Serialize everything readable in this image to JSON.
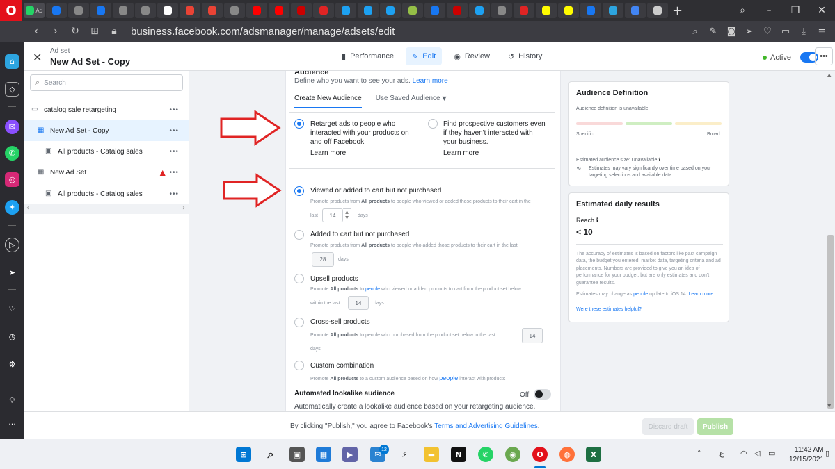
{
  "browser": {
    "url": "business.facebook.com/adsmanager/manage/adsets/edit",
    "logo": "O",
    "active_tab_label": "Ac",
    "tabs": [
      {
        "color": "#25d366",
        "icon": "whatsapp-icon"
      },
      {
        "color": "#1877f2",
        "icon": "meta-icon"
      },
      {
        "color": "#888888",
        "icon": "page-icon"
      },
      {
        "color": "#1877f2",
        "icon": "meta-icon"
      },
      {
        "color": "#888888",
        "icon": "circle-icon"
      },
      {
        "color": "#888888",
        "icon": "page-icon"
      },
      {
        "color": "#ffffff",
        "icon": "google-icon"
      },
      {
        "color": "#ea4335",
        "icon": "gmail-icon"
      },
      {
        "color": "#ea4335",
        "icon": "gmail-icon"
      },
      {
        "color": "#888888",
        "icon": "page-icon"
      },
      {
        "color": "#ff0000",
        "icon": "youtube-icon"
      },
      {
        "color": "#ff0000",
        "icon": "youtube-icon"
      },
      {
        "color": "#cc0000",
        "icon": "news-icon"
      },
      {
        "color": "#e02424",
        "icon": "chart-icon"
      },
      {
        "color": "#1da1f2",
        "icon": "twitter-icon"
      },
      {
        "color": "#1da1f2",
        "icon": "twitter-icon"
      },
      {
        "color": "#1da1f2",
        "icon": "twitter-icon"
      },
      {
        "color": "#95bf47",
        "icon": "shopify-icon"
      },
      {
        "color": "#1877f2",
        "icon": "facebook-icon"
      },
      {
        "color": "#cc0000",
        "icon": "news-icon"
      },
      {
        "color": "#1da1f2",
        "icon": "twitter-icon"
      },
      {
        "color": "#888888",
        "icon": "circle-icon"
      },
      {
        "color": "#e02424",
        "icon": "pin-icon"
      },
      {
        "color": "#fffc00",
        "icon": "snapchat-icon"
      },
      {
        "color": "#fffc00",
        "icon": "snapchat-icon"
      },
      {
        "color": "#1877f2",
        "icon": "facebook-icon"
      },
      {
        "color": "#2da5e0",
        "icon": "box-icon"
      },
      {
        "color": "#4285f4",
        "icon": "translate-icon"
      },
      {
        "color": "#cccccc",
        "icon": "grid-icon"
      }
    ]
  },
  "header": {
    "adset_label": "Ad set",
    "adset_title": "New Ad Set - Copy",
    "tabs": [
      {
        "label": "Performance",
        "icon": "bar-chart-icon"
      },
      {
        "label": "Edit",
        "icon": "pencil-icon"
      },
      {
        "label": "Review",
        "icon": "eye-icon"
      },
      {
        "label": "History",
        "icon": "history-icon"
      }
    ],
    "status": "Active",
    "more": "•••"
  },
  "tree": {
    "search_placeholder": "Search",
    "items": [
      {
        "label": "catalog sale retargeting",
        "icon": "folder-icon"
      },
      {
        "label": "New Ad Set - Copy",
        "icon": "grid-icon"
      },
      {
        "label": "All products - Catalog sales",
        "icon": "ad-icon"
      },
      {
        "label": "New Ad Set",
        "icon": "grid-icon"
      },
      {
        "label": "All products - Catalog sales",
        "icon": "ad-icon"
      }
    ],
    "more": "•••"
  },
  "audience": {
    "heading": "Audience",
    "description": "Define who you want to see your ads.",
    "learn_more": "Learn more",
    "tab_create": "Create New Audience",
    "tab_saved": "Use Saved Audience",
    "option_retarget": "Retarget ads to people who interacted with your products on and off Facebook.",
    "option_prospect": "Find prospective customers even if they haven't interacted with your business.",
    "learn_more_1": "Learn more",
    "learn_more_2": "Learn more",
    "viewed": {
      "title": "Viewed or added to cart but not purchased",
      "sub_a": "Promote products from",
      "sub_bold": "All products",
      "sub_b": "to people who viewed or added those products to their cart in the",
      "last": "last",
      "days_value": "14",
      "days": "days"
    },
    "added": {
      "title": "Added to cart but not purchased",
      "sub_a": "Promote products from",
      "sub_bold": "All products",
      "sub_b": "to people who added those products to their cart in the last",
      "days_value": "28",
      "days": "days"
    },
    "upsell": {
      "title": "Upsell products",
      "sub_a": "Promote",
      "sub_bold": "All products",
      "sub_to": "to",
      "sub_people": "people",
      "sub_b": "who viewed or added products to cart from the product set below",
      "within": "within the last",
      "days_value": "14",
      "days": "days"
    },
    "crosssell": {
      "title": "Cross-sell products",
      "sub_a": "Promote",
      "sub_bold": "All products",
      "sub_b": "to people who purchased from the product set below in the last",
      "days_value": "14",
      "days": "days"
    },
    "custom": {
      "title": "Custom combination",
      "sub_a": "Promote",
      "sub_bold": "All products",
      "sub_b": "to a custom audience based on how",
      "sub_people": "people",
      "sub_c": "interact with products"
    },
    "lookalike_title": "Automated lookalike audience",
    "lookalike_desc": "Automatically create a lookalike audience based on your retargeting audience.",
    "lookalike_state": "Off"
  },
  "definition": {
    "title": "Audience Definition",
    "unavailable": "Audience definition is unavailable.",
    "specific": "Specific",
    "broad": "Broad",
    "size": "Estimated audience size: Unavailable",
    "note": "Estimates may vary significantly over time based on your targeting selections and available data.",
    "gauge_colors": [
      "#f9d9d9",
      "#cfeec2",
      "#fbeec9"
    ]
  },
  "estimates": {
    "title": "Estimated daily results",
    "reach_label": "Reach",
    "reach_value": "< 10",
    "disclaimer": "The accuracy of estimates is based on factors like past campaign data, the budget you entered, market data, targeting criteria and ad placements. Numbers are provided to give you an idea of performance for your budget, but are only estimates and don't guarantee results.",
    "ios_a": "Estimates may change as",
    "ios_people": "people",
    "ios_b": "update to iOS 14.",
    "ios_learn": "Learn more",
    "helpful": "Were these estimates helpful?"
  },
  "footer": {
    "text_a": "By clicking \"Publish,\" you agree to Facebook's",
    "terms": "Terms and Advertising Guidelines",
    "text_b": ".",
    "discard": "Discard draft",
    "publish": "Publish"
  },
  "taskbar": {
    "badge": "12",
    "time": "11:42 AM",
    "date": "12/15/2021",
    "lang": "ع"
  },
  "colors": {
    "accent": "#1877f2",
    "arrow": "#e02424",
    "publish_disabled": "#b6e1a7"
  }
}
